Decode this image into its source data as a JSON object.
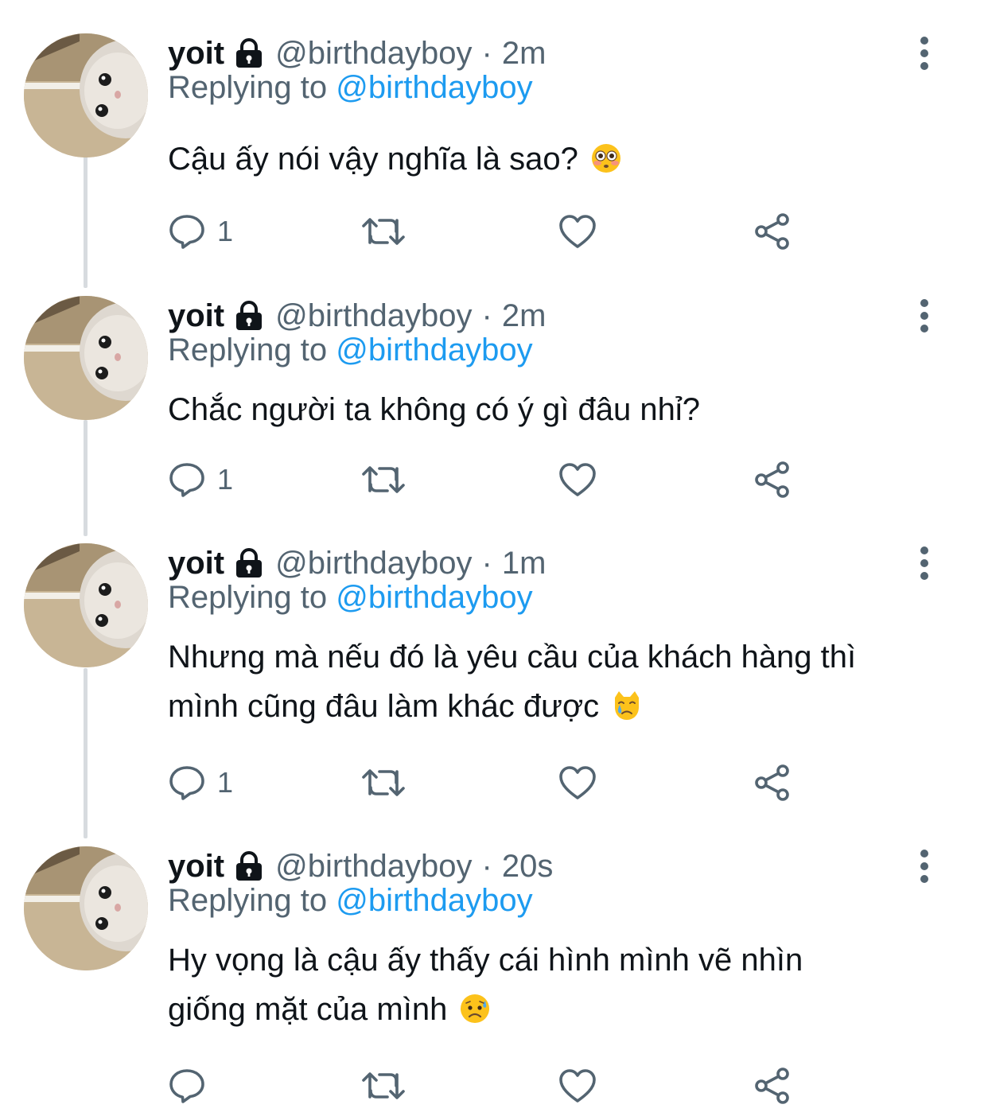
{
  "tweets": [
    {
      "display_name": "yoit",
      "handle": "@birthdayboy",
      "separator": "·",
      "time": "2m",
      "replying_prefix": "Replying to",
      "replying_to": "@birthdayboy",
      "text_lines": [
        "Cậu ấy nói vậy nghĩa là sao?"
      ],
      "emoji": "flushed-face",
      "reply_count": "1"
    },
    {
      "display_name": "yoit",
      "handle": "@birthdayboy",
      "separator": "·",
      "time": "2m",
      "replying_prefix": "Replying to",
      "replying_to": "@birthdayboy",
      "text_lines": [
        "Chắc người ta không có ý gì đâu nhỉ?"
      ],
      "emoji": "",
      "reply_count": "1"
    },
    {
      "display_name": "yoit",
      "handle": "@birthdayboy",
      "separator": "·",
      "time": "1m",
      "replying_prefix": "Replying to",
      "replying_to": "@birthdayboy",
      "text_lines": [
        "Nhưng mà nếu đó là yêu cầu của khách hàng thì",
        "mình cũng đâu làm khác được"
      ],
      "emoji": "crying-cat-face",
      "reply_count": "1"
    },
    {
      "display_name": "yoit",
      "handle": "@birthdayboy",
      "separator": "·",
      "time": "20s",
      "replying_prefix": "Replying to",
      "replying_to": "@birthdayboy",
      "text_lines": [
        "Hy vọng là cậu ấy thấy cái hình mình vẽ nhìn",
        "giống mặt của mình"
      ],
      "emoji": "sad-sweat-face",
      "reply_count": ""
    }
  ],
  "icons": {
    "reply": "reply-icon",
    "retweet": "retweet-icon",
    "like": "heart-icon",
    "share": "share-icon",
    "more": "more-vertical-icon",
    "lock": "lock-icon"
  },
  "colors": {
    "text": "#0f1419",
    "secondary": "#536471",
    "link": "#1d9bf0",
    "thread_line": "#d7dbdf"
  }
}
